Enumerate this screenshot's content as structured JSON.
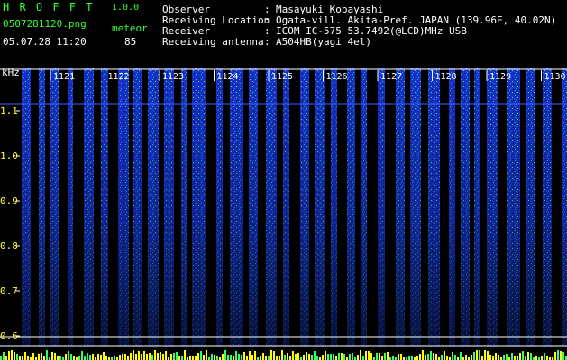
{
  "header": {
    "app_name": "H R O F F T",
    "version": "1.0.0",
    "filename": "0507281120.png",
    "datetime": "05.07.28 11:20",
    "event_label": "meteor",
    "event_count": "85",
    "info_labels": [
      "Observer",
      "Receiving Location",
      "Receiver",
      "Receiving antenna"
    ],
    "info_separator": ":",
    "info_values": [
      "Masayuki Kobayashi",
      "Ogata-vill. Akita-Pref. JAPAN (139.96E, 40.02N)",
      "ICOM IC-575 53.7492(@LCD)MHz USB",
      "A504HB(yagi 4el)"
    ]
  },
  "plot": {
    "unit": "kHz",
    "y_ticks": [
      "1.1",
      "1.0",
      "0.9",
      "0.8",
      "0.7",
      "0.6"
    ],
    "time_ticks": [
      "1121",
      "1122",
      "1123",
      "1124",
      "1125",
      "1126",
      "1127",
      "1128",
      "1129",
      "1130"
    ],
    "colors": {
      "bg": "#000000",
      "dense": "#1a3cff",
      "hot": "#00e0d0",
      "warm": "#33ff66",
      "baseline": "#ffff00"
    }
  }
}
